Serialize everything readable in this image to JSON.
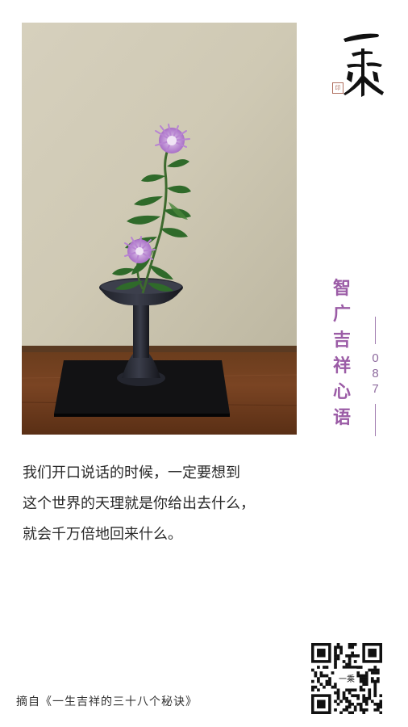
{
  "logo": {
    "name": "一乘",
    "seal_text": "印"
  },
  "title": {
    "chars": [
      "智",
      "广",
      "吉",
      "祥",
      "心",
      "语"
    ],
    "color": "#9b5ca6"
  },
  "issue": {
    "digits": [
      "0",
      "8",
      "7"
    ]
  },
  "quote": {
    "lines": [
      "我们开口说话的时候，一定要想到",
      "这个世界的天理就是你给出去什么，",
      "就会千万倍地回来什么。"
    ]
  },
  "source": {
    "text": "摘自《一生吉祥的三十八个秘诀》"
  },
  "photo": {
    "subject": "chrysanthemum-ikebana-in-dark-vase"
  },
  "qr": {
    "center_text": "一乘"
  }
}
